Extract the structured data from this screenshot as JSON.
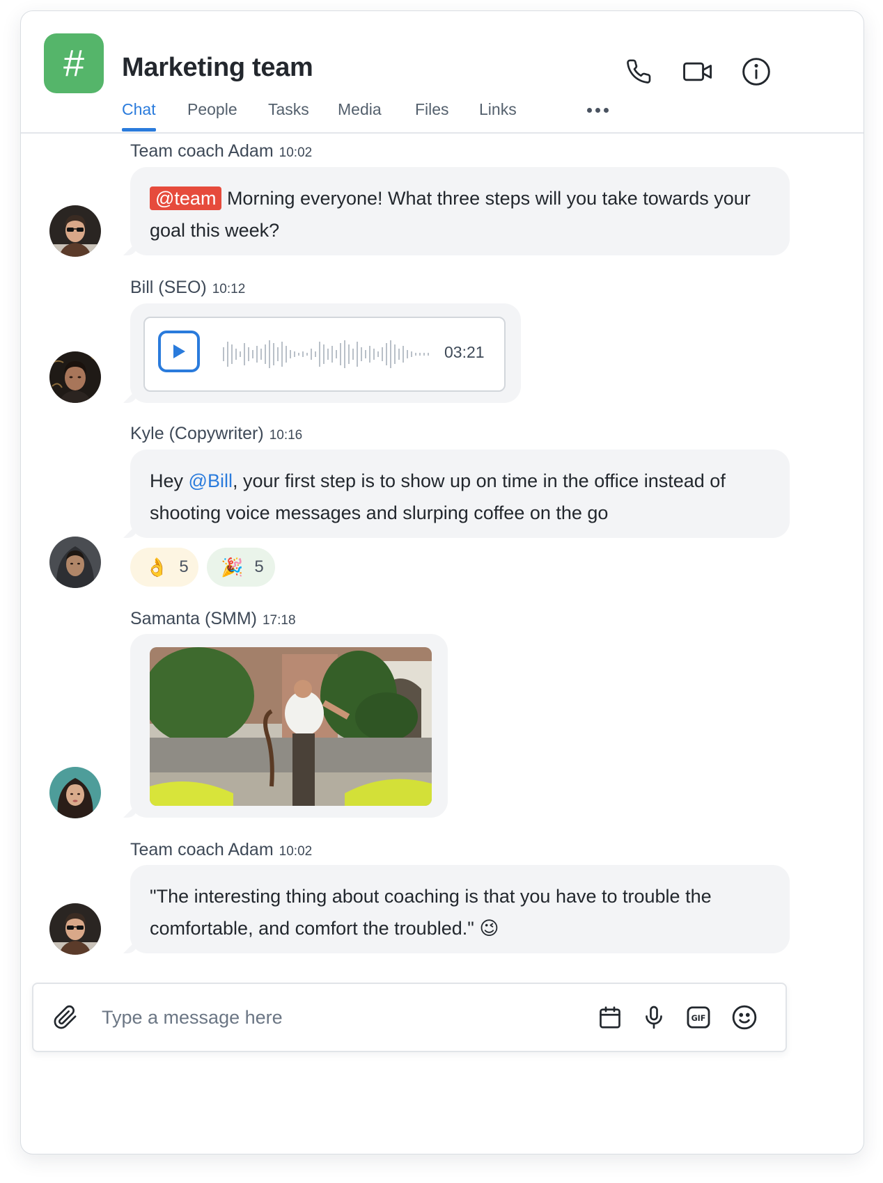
{
  "header": {
    "channel_symbol": "#",
    "channel_color": "#55b56a",
    "title": "Marketing team",
    "icons": [
      "phone-icon",
      "video-icon",
      "info-icon"
    ],
    "tabs": [
      {
        "label": "Chat",
        "active": true
      },
      {
        "label": "People",
        "active": false
      },
      {
        "label": "Tasks",
        "active": false
      },
      {
        "label": "Media",
        "active": false
      },
      {
        "label": "Files",
        "active": false
      },
      {
        "label": "Links",
        "active": false
      }
    ],
    "more_icon": "more-dots-icon"
  },
  "messages": [
    {
      "author": "Team coach Adam",
      "time": "10:02",
      "mention": "@team",
      "text": " Morning everyone! What three steps will you take towards your goal this week?"
    },
    {
      "author": "Bill (SEO)",
      "time": "10:12",
      "voice_duration": "03:21"
    },
    {
      "author": "Kyle (Copywriter)",
      "time": "10:16",
      "text_before": "Hey ",
      "mention": "@Bill",
      "text_after": ", your first step is to show up on time in the office instead of shooting voice messages and slurping coffee on the go",
      "reactions": [
        {
          "emoji": "👌",
          "count": "5"
        },
        {
          "emoji": "🎉",
          "count": "5"
        }
      ]
    },
    {
      "author": "Samanta (SMM)",
      "time": "17:18",
      "attachment": "gif-image"
    },
    {
      "author": "Team coach Adam",
      "time": "10:02",
      "text": "\"The interesting thing about coaching is that you have to trouble the comfortable, and comfort the troubled.\"",
      "emoji": "😉"
    }
  ],
  "composer": {
    "placeholder": "Type a message here",
    "icons": [
      "paperclip-icon",
      "calendar-icon",
      "microphone-icon",
      "gif-icon",
      "smiley-icon"
    ]
  },
  "colors": {
    "accent": "#2a7bdc",
    "mention_bg": "#e64b3c",
    "bubble_bg": "#f3f4f6"
  }
}
